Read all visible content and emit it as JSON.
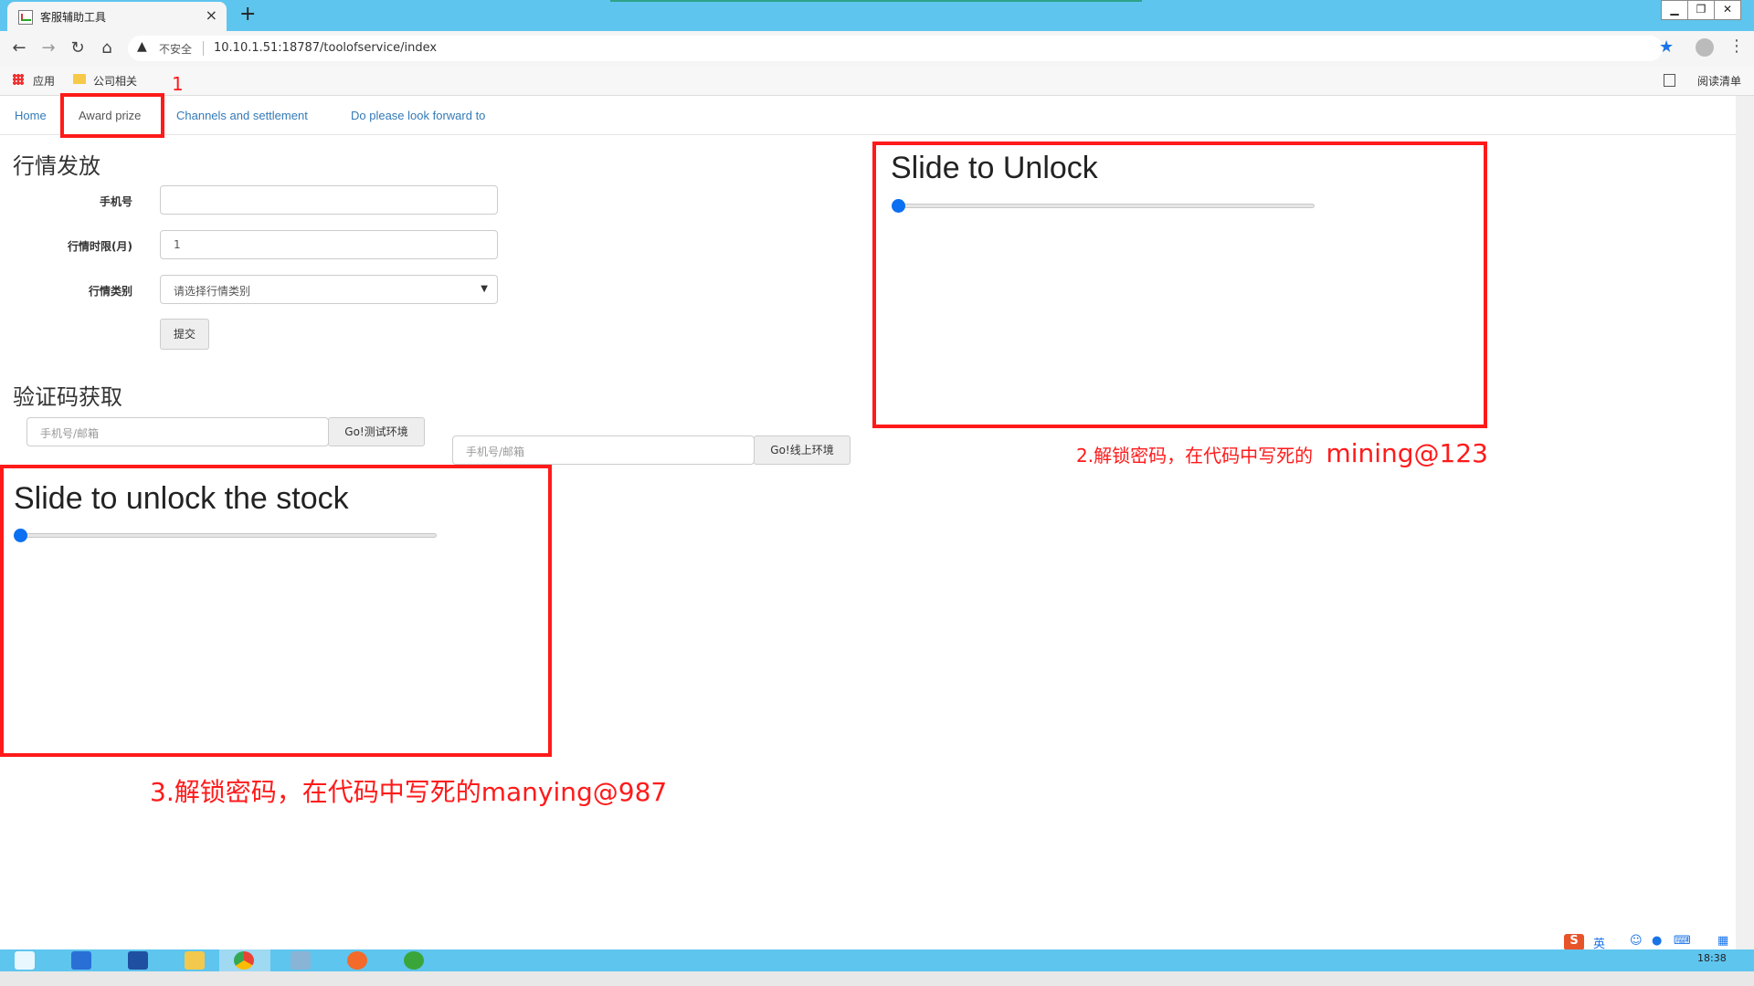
{
  "browser": {
    "tab_title": "客服辅助工具",
    "tab_close": "×",
    "new_tab": "+",
    "insecure_label": "不安全",
    "url": "10.10.1.51:18787/toolofservice/index",
    "bookmarks": {
      "apps": "应用",
      "company": "公司相关",
      "reading_list": "阅读清单"
    },
    "win_controls": [
      "▁",
      "❐",
      "✕"
    ]
  },
  "nav": {
    "items": [
      {
        "label": "Home"
      },
      {
        "label": "Award prize"
      },
      {
        "label": "Channels and settlement"
      },
      {
        "label": "Do please look forward to"
      }
    ]
  },
  "market_form": {
    "title": "行情发放",
    "phone_label": "手机号",
    "phone_value": "",
    "months_label": "行情时限(月)",
    "months_value": "1",
    "type_label": "行情类别",
    "type_selected": "请选择行情类别",
    "submit": "提交"
  },
  "code_section": {
    "title": "验证码获取",
    "test_placeholder": "手机号/邮箱",
    "test_button": "Go!测试环境",
    "prod_placeholder": "手机号/邮箱",
    "prod_button": "Go!线上环境"
  },
  "sliders": {
    "unlock": {
      "title": "Slide to Unlock",
      "value": 0
    },
    "stock": {
      "title": "Slide to unlock the stock",
      "value": 0
    }
  },
  "annotations": {
    "one": "1",
    "two_prefix": "2.解锁密码，在代码中写死的",
    "two_code": "mining@123",
    "three": "3.解锁密码，在代码中写死的manying@987"
  },
  "taskbar": {
    "time": "18:38",
    "ime": "英"
  },
  "colors": {
    "annotation": "#ff1a1a",
    "link": "#337ab7",
    "slider_knob": "#0b6ff2",
    "chrome": "#5ec5ee"
  }
}
